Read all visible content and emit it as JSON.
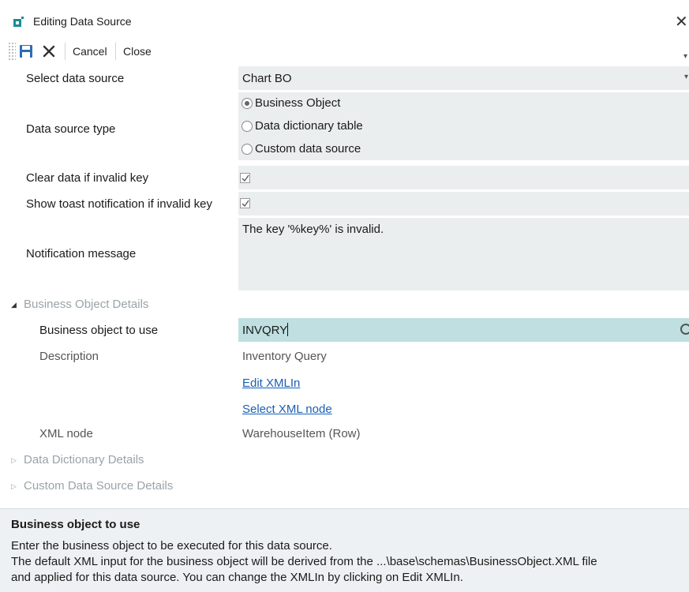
{
  "window": {
    "title": "Editing Data Source",
    "close_glyph": "✕"
  },
  "toolbar": {
    "cancel_label": "Cancel",
    "close_label": "Close"
  },
  "form": {
    "select_data_source": {
      "label": "Select data source",
      "value": "Chart BO"
    },
    "data_source_type": {
      "label": "Data source type",
      "options": [
        "Business Object",
        "Data dictionary table",
        "Custom data source"
      ],
      "selected": "Business Object"
    },
    "clear_data": {
      "label": "Clear data if invalid key",
      "checked": true
    },
    "show_toast": {
      "label": "Show toast notification if invalid key",
      "checked": true
    },
    "notification_message": {
      "label": "Notification message",
      "value": "The key '%key%' is invalid."
    }
  },
  "sections": {
    "business_object": {
      "title": "Business Object Details",
      "expanded": true,
      "bo_to_use": {
        "label": "Business object to use",
        "value": "INVQRY"
      },
      "description": {
        "label": "Description",
        "value": "Inventory Query"
      },
      "edit_xmlin_link": "Edit XMLIn",
      "select_xml_node_link": "Select XML node",
      "xml_node": {
        "label": "XML node",
        "value": "WarehouseItem (Row)"
      }
    },
    "data_dictionary": {
      "title": "Data Dictionary Details",
      "expanded": false
    },
    "custom_data_source": {
      "title": "Custom Data Source Details",
      "expanded": false
    }
  },
  "help": {
    "title": "Business object to use",
    "lines": [
      "Enter the business object to be executed for this data source.",
      "The default XML input for the business object will be derived from the ...\\base\\schemas\\BusinessObject.XML file",
      "and applied for this data source. You can change the XMLIn by clicking on Edit XMLIn."
    ]
  },
  "colors": {
    "accent": "#1a5fb4",
    "field_bg": "#ebeeef",
    "highlight_bg": "#bfdfe0",
    "icon_blue": "#2d6db5"
  }
}
